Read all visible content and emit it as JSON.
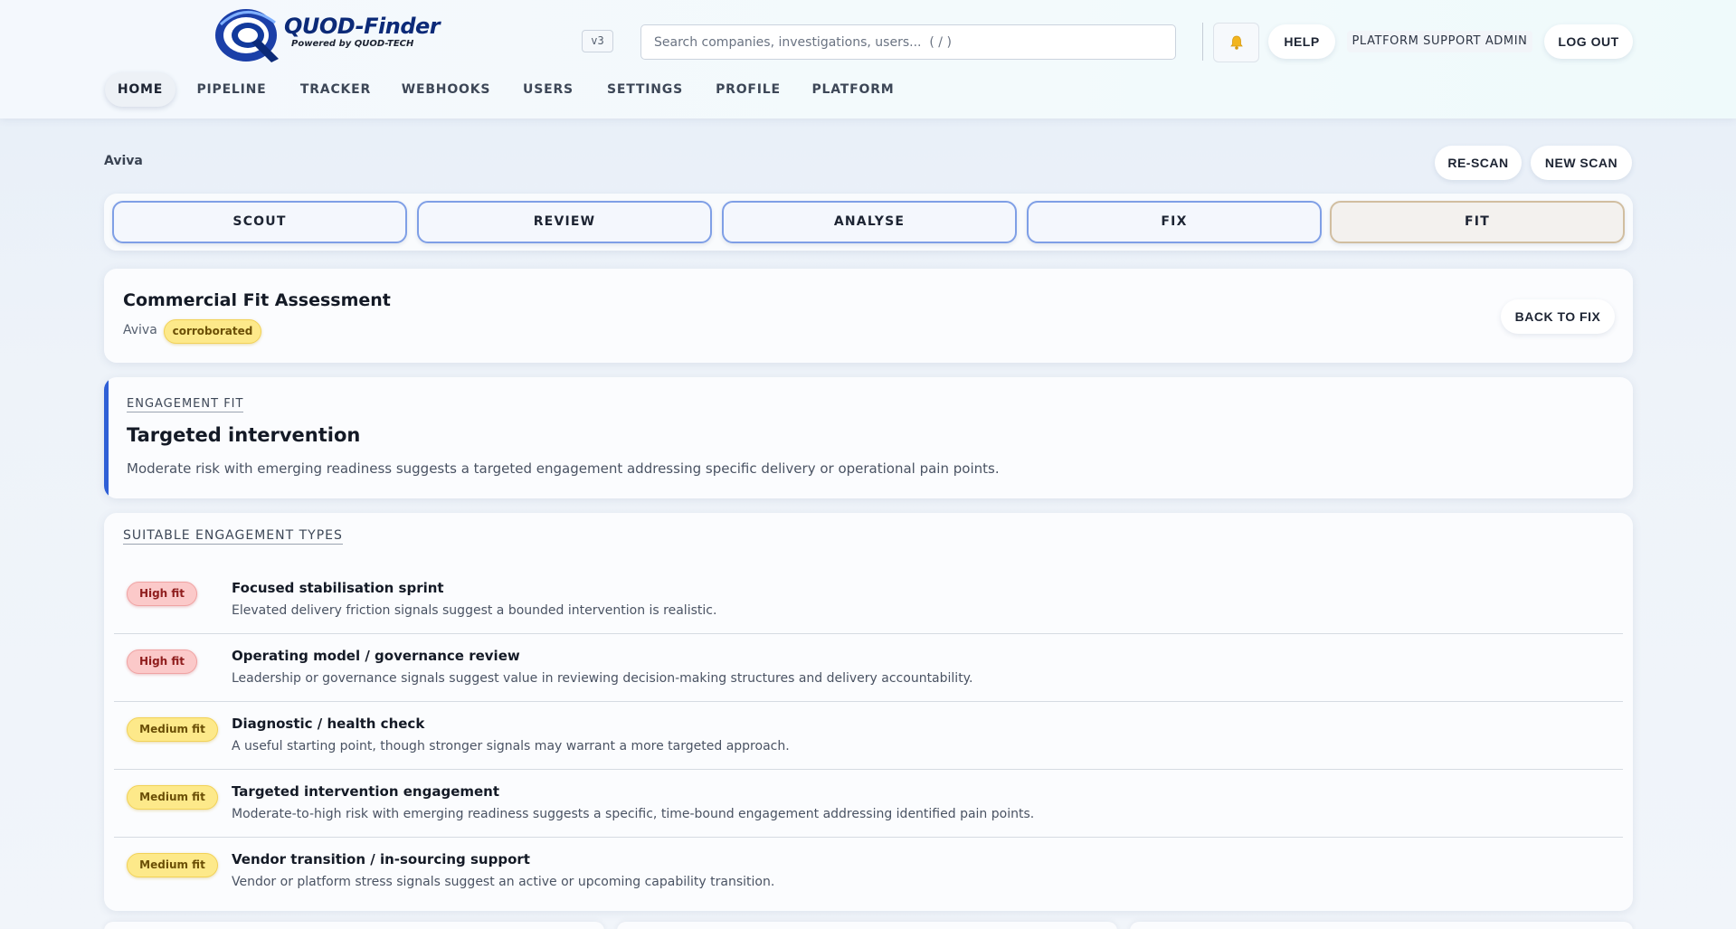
{
  "brand": {
    "name": "QUOD-Finder",
    "tagline": "Powered by QUOD-TECH",
    "version": "v3"
  },
  "header": {
    "search_placeholder": "Search companies, investigations, users...  ( / )",
    "help_label": "HELP",
    "user_label": "PLATFORM SUPPORT ADMIN",
    "logout_label": "LOG OUT"
  },
  "nav": {
    "items": [
      "HOME",
      "PIPELINE",
      "TRACKER",
      "WEBHOOKS",
      "USERS",
      "SETTINGS",
      "PROFILE",
      "PLATFORM"
    ],
    "active": "HOME"
  },
  "company_row": {
    "company": "Aviva",
    "rescan_label": "RE-SCAN",
    "newscan_label": "NEW SCAN"
  },
  "stages": {
    "items": [
      "SCOUT",
      "REVIEW",
      "ANALYSE",
      "FIX",
      "FIT"
    ],
    "active": "FIT"
  },
  "assessment": {
    "title": "Commercial Fit Assessment",
    "company": "Aviva",
    "status_badge": "corroborated",
    "back_label": "BACK TO FIX"
  },
  "engagement_fit": {
    "label": "ENGAGEMENT FIT",
    "title": "Targeted intervention",
    "description": "Moderate risk with emerging readiness suggests a targeted engagement addressing specific delivery or operational pain points."
  },
  "engagement_types": {
    "label": "SUITABLE ENGAGEMENT TYPES",
    "items": [
      {
        "fit": "High fit",
        "title": "Focused stabilisation sprint",
        "description": "Elevated delivery friction signals suggest a bounded intervention is realistic."
      },
      {
        "fit": "High fit",
        "title": "Operating model / governance review",
        "description": "Leadership or governance signals suggest value in reviewing decision-making structures and delivery accountability."
      },
      {
        "fit": "Medium fit",
        "title": "Diagnostic / health check",
        "description": "A useful starting point, though stronger signals may warrant a more targeted approach."
      },
      {
        "fit": "Medium fit",
        "title": "Targeted intervention engagement",
        "description": "Moderate-to-high risk with emerging readiness suggests a specific, time-bound engagement addressing identified pain points."
      },
      {
        "fit": "Medium fit",
        "title": "Vendor transition / in-sourcing support",
        "description": "Vendor or platform stress signals suggest an active or upcoming capability transition."
      }
    ]
  },
  "colors": {
    "accent_blue": "#2f5fd6",
    "high_fit": "#fbc9c9",
    "medium_fit": "#fde98a"
  },
  "icons": {
    "logo": "quod-q-logo",
    "notifications": "bell-icon"
  }
}
